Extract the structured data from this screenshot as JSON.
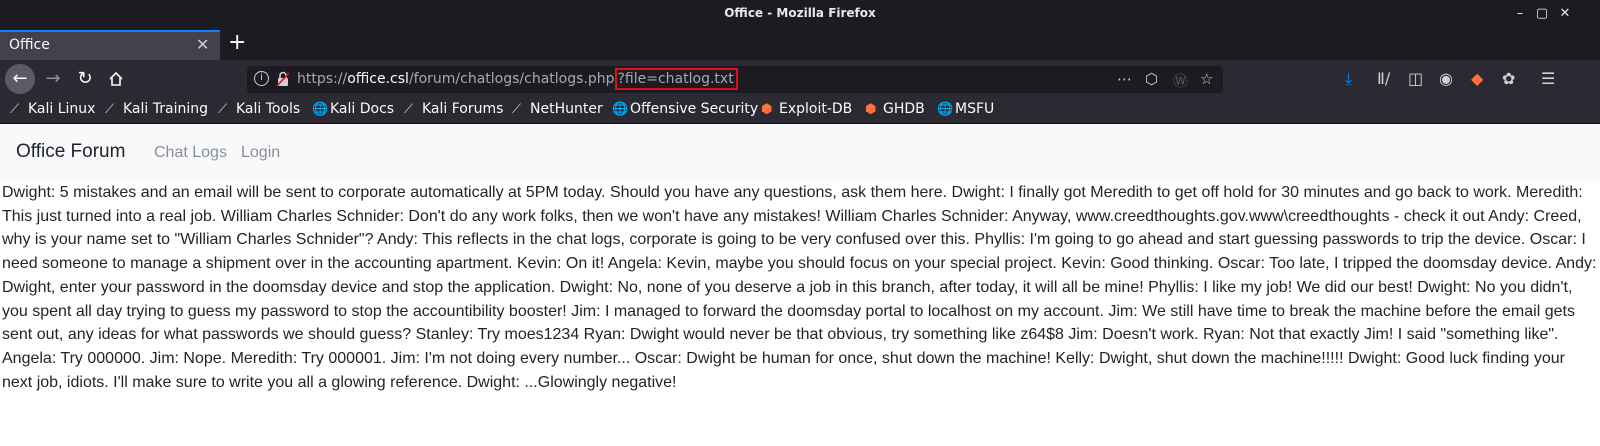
{
  "window": {
    "title": "Office - Mozilla Firefox",
    "controls": [
      "minimize",
      "maximize",
      "close"
    ]
  },
  "tabs": [
    {
      "label": "Office",
      "active": true
    }
  ],
  "urlbar": {
    "prefix": "https://",
    "host": "office.csl",
    "path": "/forum/chatlogs/chatlogs.php",
    "query": "?file=chatlog.txt"
  },
  "bookmarks": [
    {
      "label": "Kali Linux",
      "icon": "kali-dragon-icon"
    },
    {
      "label": "Kali Training",
      "icon": "kali-dragon-icon"
    },
    {
      "label": "Kali Tools",
      "icon": "kali-dragon-icon"
    },
    {
      "label": "Kali Docs",
      "icon": "globe-icon"
    },
    {
      "label": "Kali Forums",
      "icon": "kali-dragon-icon"
    },
    {
      "label": "NetHunter",
      "icon": "kali-dragon-icon"
    },
    {
      "label": "Offensive Security",
      "icon": "globe-icon"
    },
    {
      "label": "Exploit-DB",
      "icon": "exploit-db-icon"
    },
    {
      "label": "GHDB",
      "icon": "exploit-db-icon"
    },
    {
      "label": "MSFU",
      "icon": "globe-icon"
    }
  ],
  "site": {
    "brand": "Office Forum",
    "nav": [
      "Chat Logs",
      "Login"
    ]
  },
  "chatlog": "Dwight: 5 mistakes and an email will be sent to corporate automatically at 5PM today. Should you have any questions, ask them here. Dwight: I finally got Meredith to get off hold for 30 minutes and go back to work. Meredith: This just turned into a real job. William Charles Schnider: Don't do any work folks, then we won't have any mistakes! William Charles Schnider: Anyway, www.creedthoughts.gov.www\\creedthoughts - check it out Andy: Creed, why is your name set to \"William Charles Schnider\"? Andy: This reflects in the chat logs, corporate is going to be very confused over this. Phyllis: I'm going to go ahead and start guessing passwords to trip the device. Oscar: I need someone to manage a shipment over in the accounting apartment. Kevin: On it! Angela: Kevin, maybe you should focus on your special project. Kevin: Good thinking. Oscar: Too late, I tripped the doomsday device. Andy: Dwight, enter your password in the doomsday device and stop the application. Dwight: No, none of you deserve a job in this branch, after today, it will all be mine! Phyllis: I like my job! We did our best! Dwight: No you didn't, you spent all day trying to guess my password to stop the accountibility booster! Jim: I managed to forward the doomsday portal to localhost on my account. Jim: We still have time to break the machine before the email gets sent out, any ideas for what passwords we should guess? Stanley: Try moes1234 Ryan: Dwight would never be that obvious, try something like z64$8 Jim: Doesn't work. Ryan: Not that exactly Jim! I said \"something like\". Angela: Try 000000. Jim: Nope. Meredith: Try 000001. Jim: I'm not doing every number... Oscar: Dwight be human for once, shut down the machine! Kelly: Dwight, shut down the machine!!!!! Dwight: Good luck finding your next job, idiots. I'll make sure to write you all a glowing reference. Dwight: ...Glowingly negative!",
  "colors": {
    "chrome_dark": "#1c1b22",
    "toolbar": "#2b2a33",
    "highlight_box": "#e0101a",
    "download_accent": "#0a84ff"
  }
}
